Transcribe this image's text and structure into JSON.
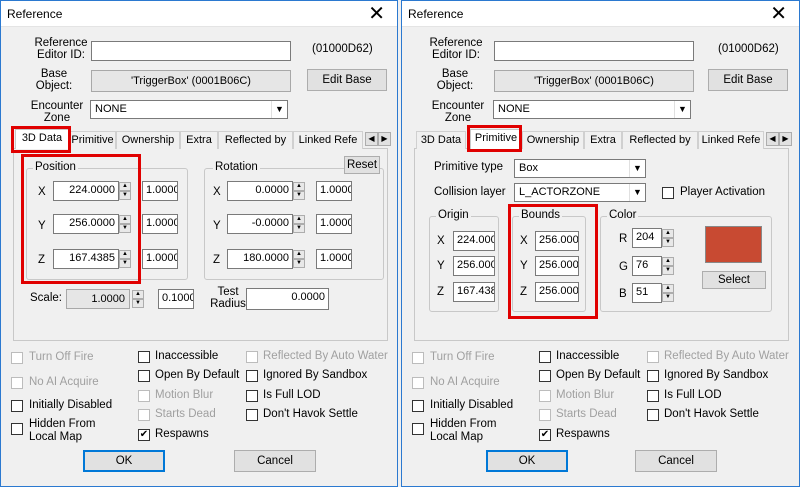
{
  "title": "Reference",
  "colors": {
    "window_border": "#2b79d0",
    "highlight": "#e00000",
    "swatch": "#c84a32"
  },
  "labels": {
    "editor_id": "Reference Editor ID:",
    "base_object": "Base Object:",
    "encounter_zone": "Encounter Zone"
  },
  "values": {
    "form_id": "(01000D62)",
    "base_object": "'TriggerBox' (0001B06C)",
    "encounter_zone": "NONE"
  },
  "buttons": {
    "edit_base": "Edit Base",
    "reset": "Reset",
    "select": "Select",
    "ok": "OK",
    "cancel": "Cancel"
  },
  "tabs": [
    "3D Data",
    "Primitive",
    "Ownership",
    "Extra",
    "Reflected by",
    "Linked Refe"
  ],
  "position": {
    "label": "Position",
    "rows": [
      {
        "axis": "X",
        "value": "224.0000",
        "scale": "1.0000"
      },
      {
        "axis": "Y",
        "value": "256.0000",
        "scale": "1.0000"
      },
      {
        "axis": "Z",
        "value": "167.4385",
        "scale": "1.0000"
      }
    ]
  },
  "rotation": {
    "label": "Rotation",
    "rows": [
      {
        "axis": "X",
        "value": "0.0000",
        "scale": "1.0000"
      },
      {
        "axis": "Y",
        "value": "-0.0000",
        "scale": "1.0000"
      },
      {
        "axis": "Z",
        "value": "180.0000",
        "scale": "1.0000"
      }
    ]
  },
  "scale": {
    "label": "Scale:",
    "value": "1.0000",
    "value2": "0.1000"
  },
  "test_radius": {
    "label": "Test Radius",
    "value": "0.0000"
  },
  "primitive": {
    "type_label": "Primitive type",
    "type_value": "Box",
    "collision_label": "Collision layer",
    "collision_value": "L_ACTORZONE",
    "player_activation": "Player Activation",
    "origin_label": "Origin",
    "origin": [
      {
        "axis": "X",
        "value": "224.000"
      },
      {
        "axis": "Y",
        "value": "256.000"
      },
      {
        "axis": "Z",
        "value": "167.438"
      }
    ],
    "bounds_label": "Bounds",
    "bounds": [
      {
        "axis": "X",
        "value": "256.000"
      },
      {
        "axis": "Y",
        "value": "256.000"
      },
      {
        "axis": "Z",
        "value": "256.000"
      }
    ],
    "color_label": "Color",
    "color": [
      {
        "axis": "R",
        "value": "204"
      },
      {
        "axis": "G",
        "value": "76"
      },
      {
        "axis": "B",
        "value": "51"
      }
    ]
  },
  "checks": {
    "turn_off_fire": "Turn Off Fire",
    "no_ai_acquire": "No AI Acquire",
    "initially_disabled": "Initially Disabled",
    "hidden_from_local_map": "Hidden From Local Map",
    "inaccessible": "Inaccessible",
    "open_by_default": "Open By Default",
    "motion_blur": "Motion Blur",
    "starts_dead": "Starts Dead",
    "respawns": "Respawns",
    "reflected_by_auto_water": "Reflected By Auto Water",
    "ignored_by_sandbox": "Ignored By Sandbox",
    "is_full_lod": "Is Full LOD",
    "dont_havok_settle": "Don't Havok Settle"
  }
}
